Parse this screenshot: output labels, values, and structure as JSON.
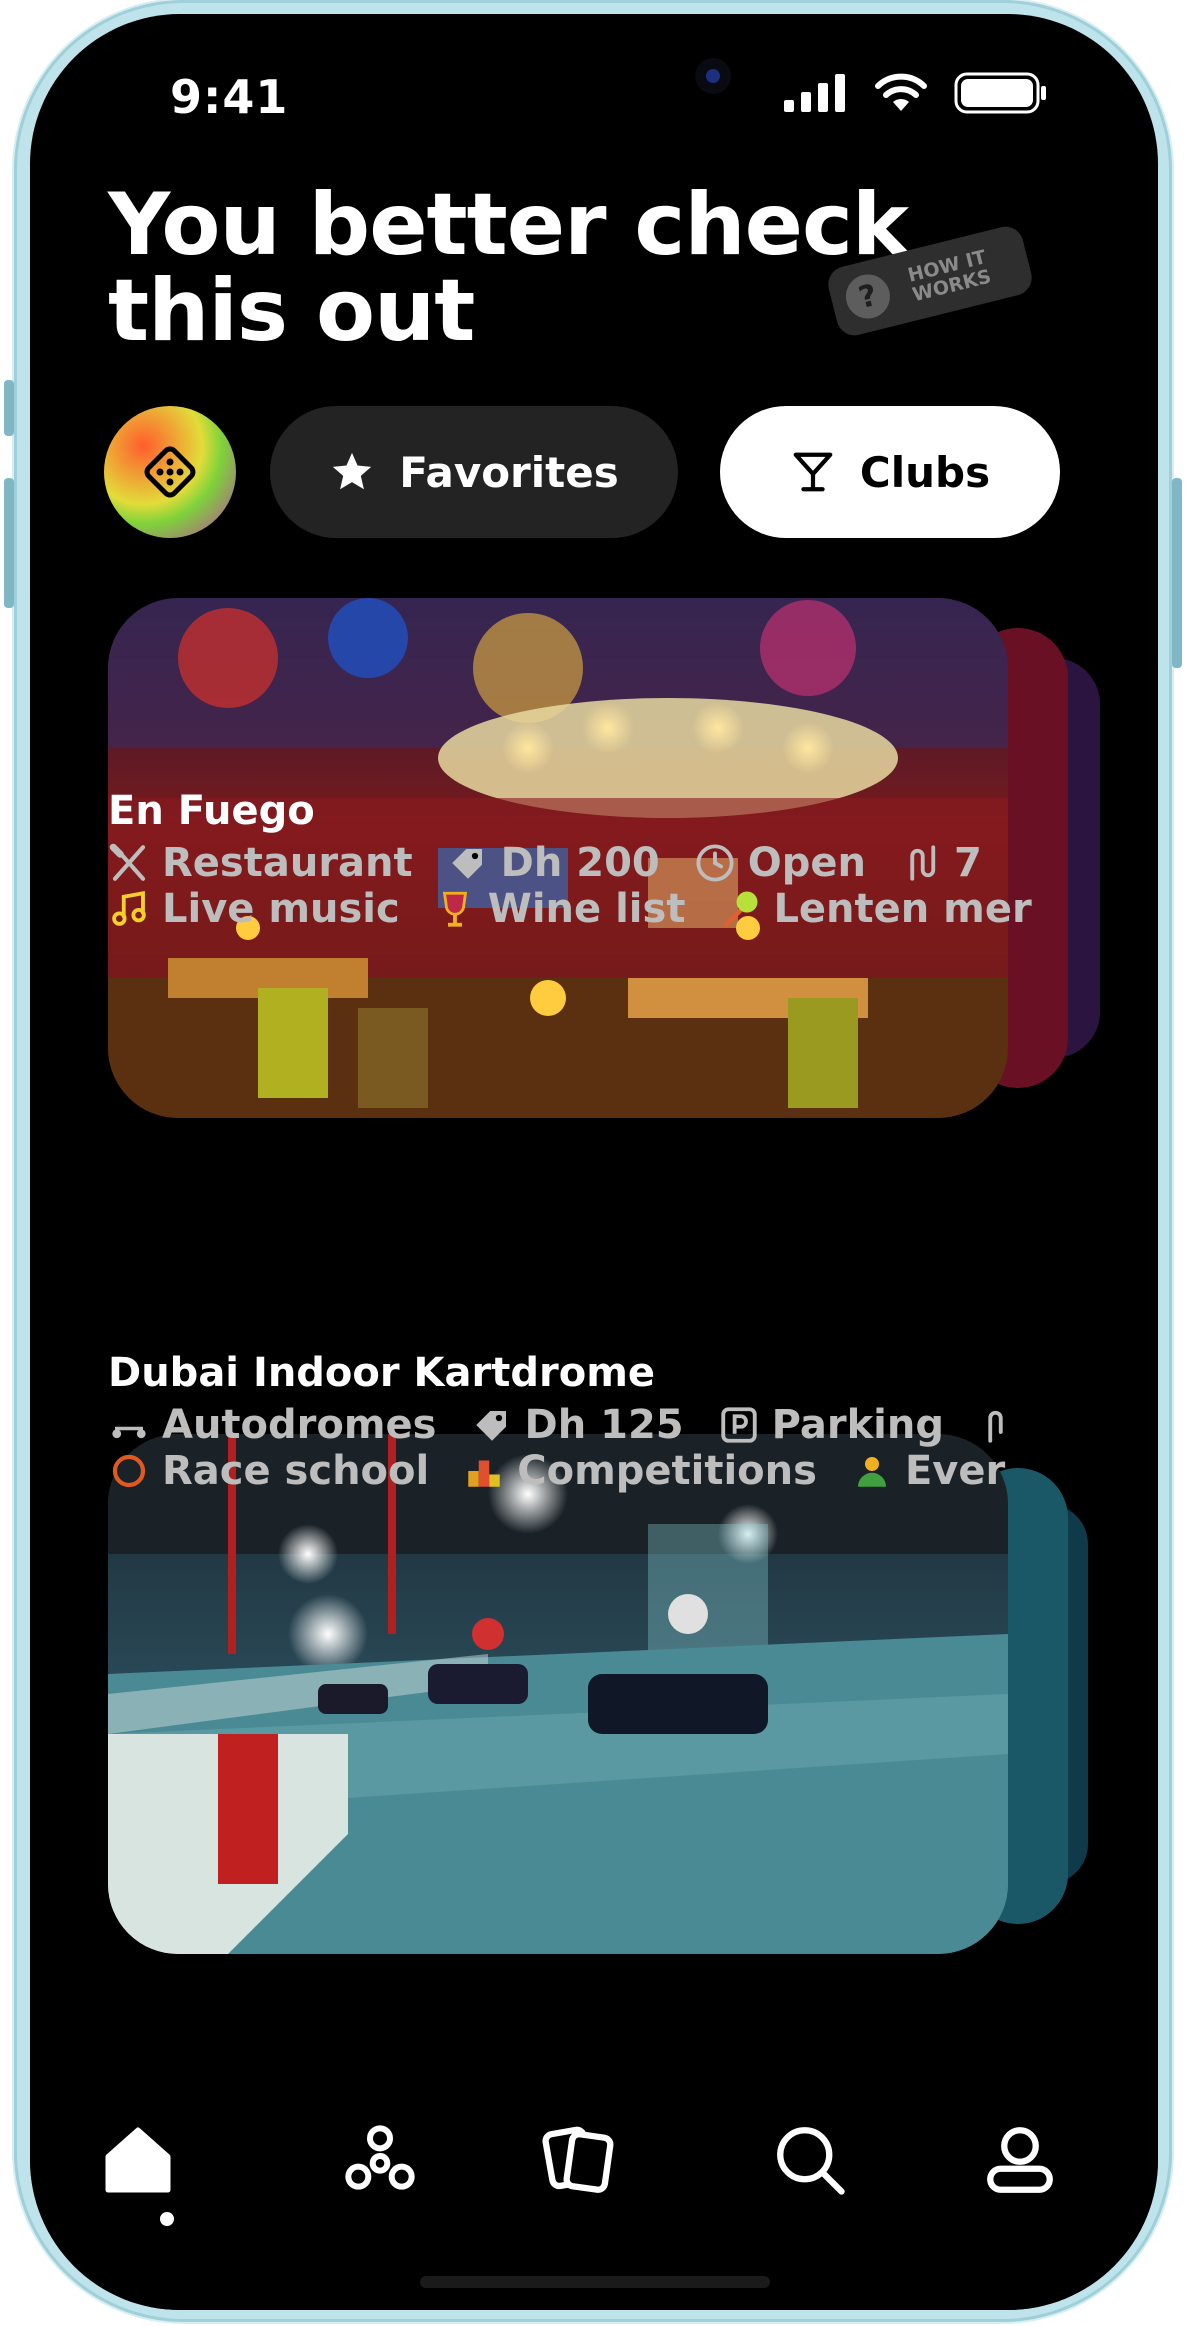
{
  "status_bar": {
    "time": "9:41"
  },
  "header": {
    "title_line1": "You better check",
    "title_line2": "this out",
    "how_badge_text": "HOW IT WORKS",
    "how_badge_symbol": "?"
  },
  "filters": {
    "favorites_label": "Favorites",
    "clubs_label": "Clubs"
  },
  "cards": [
    {
      "name": "En Fuego",
      "tags_row1": [
        {
          "icon": "fork-knife-icon",
          "label": "Restaurant"
        },
        {
          "icon": "price-tag-icon",
          "label": "Dh 200"
        },
        {
          "icon": "clock-icon",
          "label": "Open"
        },
        {
          "icon": "route-icon",
          "label": "7"
        }
      ],
      "tags_row2": [
        {
          "icon": "music-note-icon",
          "label": "Live music",
          "color": "#f2cf2c"
        },
        {
          "icon": "wine-glass-icon",
          "label": "Wine list",
          "color": "#f0b020"
        },
        {
          "icon": "lollipop-icon",
          "label": "Lenten mer",
          "color": "#b8e03a"
        }
      ]
    },
    {
      "name": "Dubai Indoor Kartdrome",
      "tags_row1": [
        {
          "icon": "kart-icon",
          "label": "Autodromes"
        },
        {
          "icon": "price-tag-icon",
          "label": "Dh 125"
        },
        {
          "icon": "parking-icon",
          "label": "Parking"
        }
      ],
      "tags_row2": [
        {
          "icon": "trophy-icon",
          "label": "Race school",
          "color": "#e05a20"
        },
        {
          "icon": "podium-icon",
          "label": "Competitions",
          "color": "#e0a020"
        },
        {
          "icon": "person-icon",
          "label": "Ever",
          "color": "#f0b020"
        }
      ]
    }
  ],
  "colors": {
    "background": "#000000",
    "chip_dark": "#232323",
    "chip_light": "#ffffff",
    "tag_text": "#bdbdbd"
  }
}
